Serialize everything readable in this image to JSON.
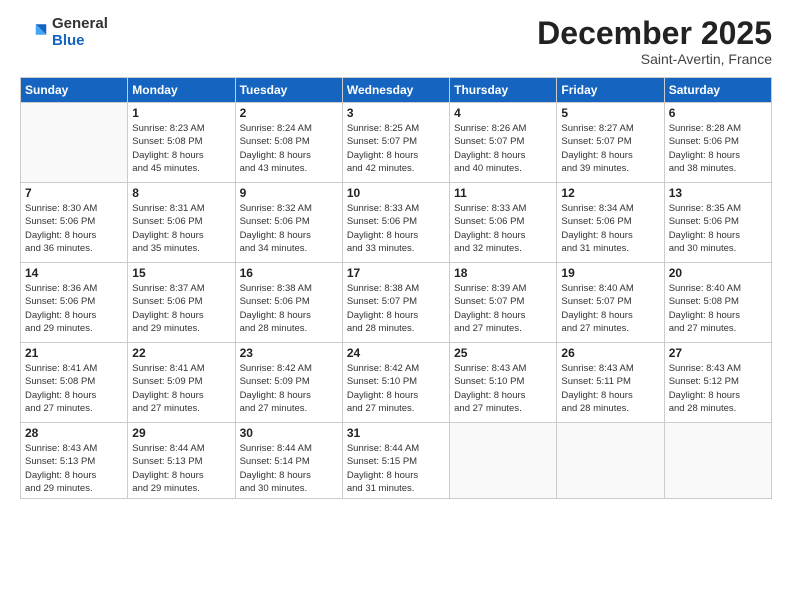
{
  "logo": {
    "general": "General",
    "blue": "Blue"
  },
  "title": "December 2025",
  "subtitle": "Saint-Avertin, France",
  "weekdays": [
    "Sunday",
    "Monday",
    "Tuesday",
    "Wednesday",
    "Thursday",
    "Friday",
    "Saturday"
  ],
  "weeks": [
    [
      {
        "day": "",
        "info": ""
      },
      {
        "day": "1",
        "info": "Sunrise: 8:23 AM\nSunset: 5:08 PM\nDaylight: 8 hours\nand 45 minutes."
      },
      {
        "day": "2",
        "info": "Sunrise: 8:24 AM\nSunset: 5:08 PM\nDaylight: 8 hours\nand 43 minutes."
      },
      {
        "day": "3",
        "info": "Sunrise: 8:25 AM\nSunset: 5:07 PM\nDaylight: 8 hours\nand 42 minutes."
      },
      {
        "day": "4",
        "info": "Sunrise: 8:26 AM\nSunset: 5:07 PM\nDaylight: 8 hours\nand 40 minutes."
      },
      {
        "day": "5",
        "info": "Sunrise: 8:27 AM\nSunset: 5:07 PM\nDaylight: 8 hours\nand 39 minutes."
      },
      {
        "day": "6",
        "info": "Sunrise: 8:28 AM\nSunset: 5:06 PM\nDaylight: 8 hours\nand 38 minutes."
      }
    ],
    [
      {
        "day": "7",
        "info": "Sunrise: 8:30 AM\nSunset: 5:06 PM\nDaylight: 8 hours\nand 36 minutes."
      },
      {
        "day": "8",
        "info": "Sunrise: 8:31 AM\nSunset: 5:06 PM\nDaylight: 8 hours\nand 35 minutes."
      },
      {
        "day": "9",
        "info": "Sunrise: 8:32 AM\nSunset: 5:06 PM\nDaylight: 8 hours\nand 34 minutes."
      },
      {
        "day": "10",
        "info": "Sunrise: 8:33 AM\nSunset: 5:06 PM\nDaylight: 8 hours\nand 33 minutes."
      },
      {
        "day": "11",
        "info": "Sunrise: 8:33 AM\nSunset: 5:06 PM\nDaylight: 8 hours\nand 32 minutes."
      },
      {
        "day": "12",
        "info": "Sunrise: 8:34 AM\nSunset: 5:06 PM\nDaylight: 8 hours\nand 31 minutes."
      },
      {
        "day": "13",
        "info": "Sunrise: 8:35 AM\nSunset: 5:06 PM\nDaylight: 8 hours\nand 30 minutes."
      }
    ],
    [
      {
        "day": "14",
        "info": "Sunrise: 8:36 AM\nSunset: 5:06 PM\nDaylight: 8 hours\nand 29 minutes."
      },
      {
        "day": "15",
        "info": "Sunrise: 8:37 AM\nSunset: 5:06 PM\nDaylight: 8 hours\nand 29 minutes."
      },
      {
        "day": "16",
        "info": "Sunrise: 8:38 AM\nSunset: 5:06 PM\nDaylight: 8 hours\nand 28 minutes."
      },
      {
        "day": "17",
        "info": "Sunrise: 8:38 AM\nSunset: 5:07 PM\nDaylight: 8 hours\nand 28 minutes."
      },
      {
        "day": "18",
        "info": "Sunrise: 8:39 AM\nSunset: 5:07 PM\nDaylight: 8 hours\nand 27 minutes."
      },
      {
        "day": "19",
        "info": "Sunrise: 8:40 AM\nSunset: 5:07 PM\nDaylight: 8 hours\nand 27 minutes."
      },
      {
        "day": "20",
        "info": "Sunrise: 8:40 AM\nSunset: 5:08 PM\nDaylight: 8 hours\nand 27 minutes."
      }
    ],
    [
      {
        "day": "21",
        "info": "Sunrise: 8:41 AM\nSunset: 5:08 PM\nDaylight: 8 hours\nand 27 minutes."
      },
      {
        "day": "22",
        "info": "Sunrise: 8:41 AM\nSunset: 5:09 PM\nDaylight: 8 hours\nand 27 minutes."
      },
      {
        "day": "23",
        "info": "Sunrise: 8:42 AM\nSunset: 5:09 PM\nDaylight: 8 hours\nand 27 minutes."
      },
      {
        "day": "24",
        "info": "Sunrise: 8:42 AM\nSunset: 5:10 PM\nDaylight: 8 hours\nand 27 minutes."
      },
      {
        "day": "25",
        "info": "Sunrise: 8:43 AM\nSunset: 5:10 PM\nDaylight: 8 hours\nand 27 minutes."
      },
      {
        "day": "26",
        "info": "Sunrise: 8:43 AM\nSunset: 5:11 PM\nDaylight: 8 hours\nand 28 minutes."
      },
      {
        "day": "27",
        "info": "Sunrise: 8:43 AM\nSunset: 5:12 PM\nDaylight: 8 hours\nand 28 minutes."
      }
    ],
    [
      {
        "day": "28",
        "info": "Sunrise: 8:43 AM\nSunset: 5:13 PM\nDaylight: 8 hours\nand 29 minutes."
      },
      {
        "day": "29",
        "info": "Sunrise: 8:44 AM\nSunset: 5:13 PM\nDaylight: 8 hours\nand 29 minutes."
      },
      {
        "day": "30",
        "info": "Sunrise: 8:44 AM\nSunset: 5:14 PM\nDaylight: 8 hours\nand 30 minutes."
      },
      {
        "day": "31",
        "info": "Sunrise: 8:44 AM\nSunset: 5:15 PM\nDaylight: 8 hours\nand 31 minutes."
      },
      {
        "day": "",
        "info": ""
      },
      {
        "day": "",
        "info": ""
      },
      {
        "day": "",
        "info": ""
      }
    ]
  ]
}
